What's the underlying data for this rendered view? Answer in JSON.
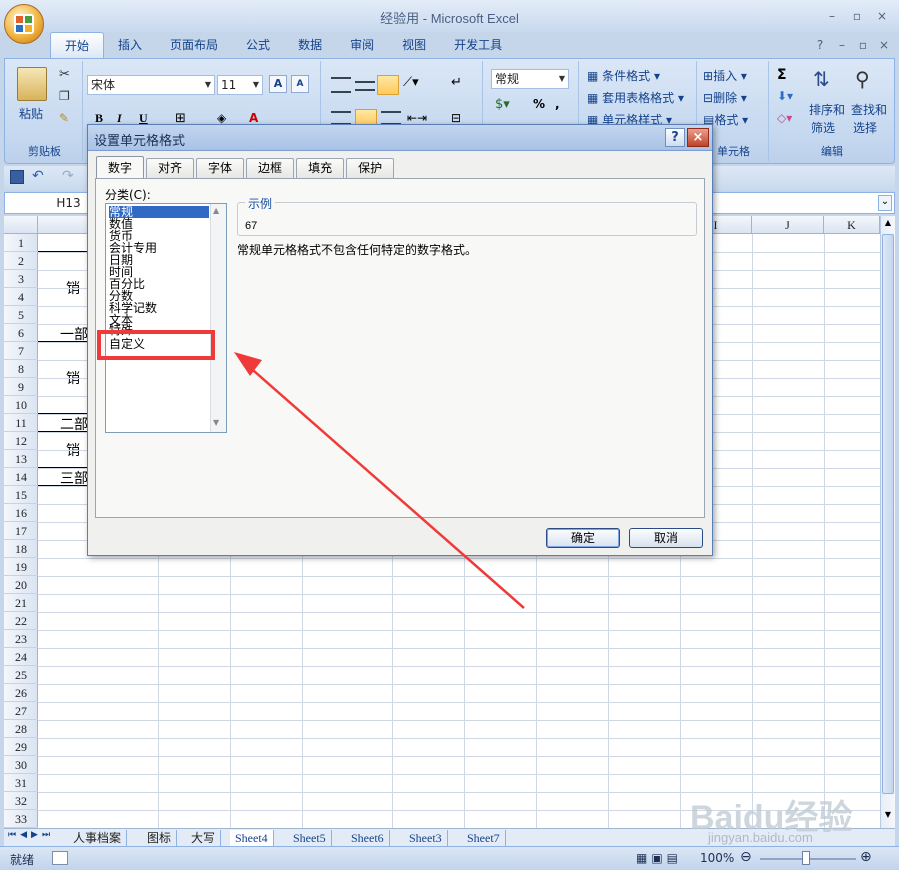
{
  "app": {
    "title": "经验用 - Microsoft Excel",
    "window_controls": [
      "–",
      "▫",
      "×"
    ],
    "doc_controls": [
      "?",
      "–",
      "▫",
      "×"
    ]
  },
  "ribbon": {
    "tabs": [
      "开始",
      "插入",
      "页面布局",
      "公式",
      "数据",
      "审阅",
      "视图",
      "开发工具"
    ],
    "active_tab": "开始",
    "clipboard": {
      "paste_label": "粘贴",
      "group_label": "剪贴板"
    },
    "font": {
      "name": "宋体",
      "size": "11",
      "bold": "B",
      "italic": "I",
      "underline": "U",
      "grow": "A",
      "shrink": "A",
      "color": "A"
    },
    "number": {
      "format": "常规",
      "percent": "%",
      "comma": ","
    },
    "styles": {
      "conditional": "条件格式",
      "table": "套用表格格式",
      "cell": "单元格样式"
    },
    "cells": {
      "insert": "插入",
      "delete": "删除",
      "format": "格式",
      "group_label": "单元格"
    },
    "editing": {
      "sort": "排序和",
      "sort2": "筛选",
      "find": "查找和",
      "find2": "选择",
      "sum": "Σ",
      "group_label": "编辑"
    }
  },
  "formula_bar": {
    "name_box": "H13"
  },
  "sheet": {
    "columns": [
      "I",
      "J",
      "K"
    ],
    "rows": [
      "1",
      "2",
      "3",
      "4",
      "5",
      "6",
      "7",
      "8",
      "9",
      "10",
      "11",
      "12",
      "13",
      "14",
      "15",
      "16",
      "17",
      "18",
      "19",
      "20",
      "21",
      "22",
      "23",
      "24",
      "25",
      "26",
      "27",
      "28",
      "29",
      "30",
      "31",
      "32",
      "33"
    ],
    "cells": {
      "r3": "销",
      "r6": "一部",
      "r8": "销",
      "r11": "二部",
      "r12": "销",
      "r14": "三部"
    }
  },
  "sheet_tabs": [
    "人事档案",
    "图标",
    "大写",
    "Sheet4",
    "Sheet5",
    "Sheet6",
    "Sheet3",
    "Sheet7"
  ],
  "status": {
    "ready": "就绪",
    "zoom": "100%"
  },
  "dialog": {
    "title": "设置单元格格式",
    "help": "?",
    "close": "×",
    "tabs": [
      "数字",
      "对齐",
      "字体",
      "边框",
      "填充",
      "保护"
    ],
    "active_tab": "数字",
    "category_label": "分类(C):",
    "categories": [
      "常规",
      "数值",
      "货币",
      "会计专用",
      "日期",
      "时间",
      "百分比",
      "分数",
      "科学记数",
      "文本",
      "特殊",
      "自定义"
    ],
    "selected_category": "常规",
    "sample_label": "示例",
    "sample_value": "67",
    "description": "常规单元格格式不包含任何特定的数字格式。",
    "ok": "确定",
    "cancel": "取消"
  },
  "watermark": {
    "brand": "Baidu经验",
    "url": "jingyan.baidu.com"
  },
  "colors": {
    "accent": "#15428b",
    "highlight": "#f03a3a",
    "selection": "#316ac5"
  }
}
